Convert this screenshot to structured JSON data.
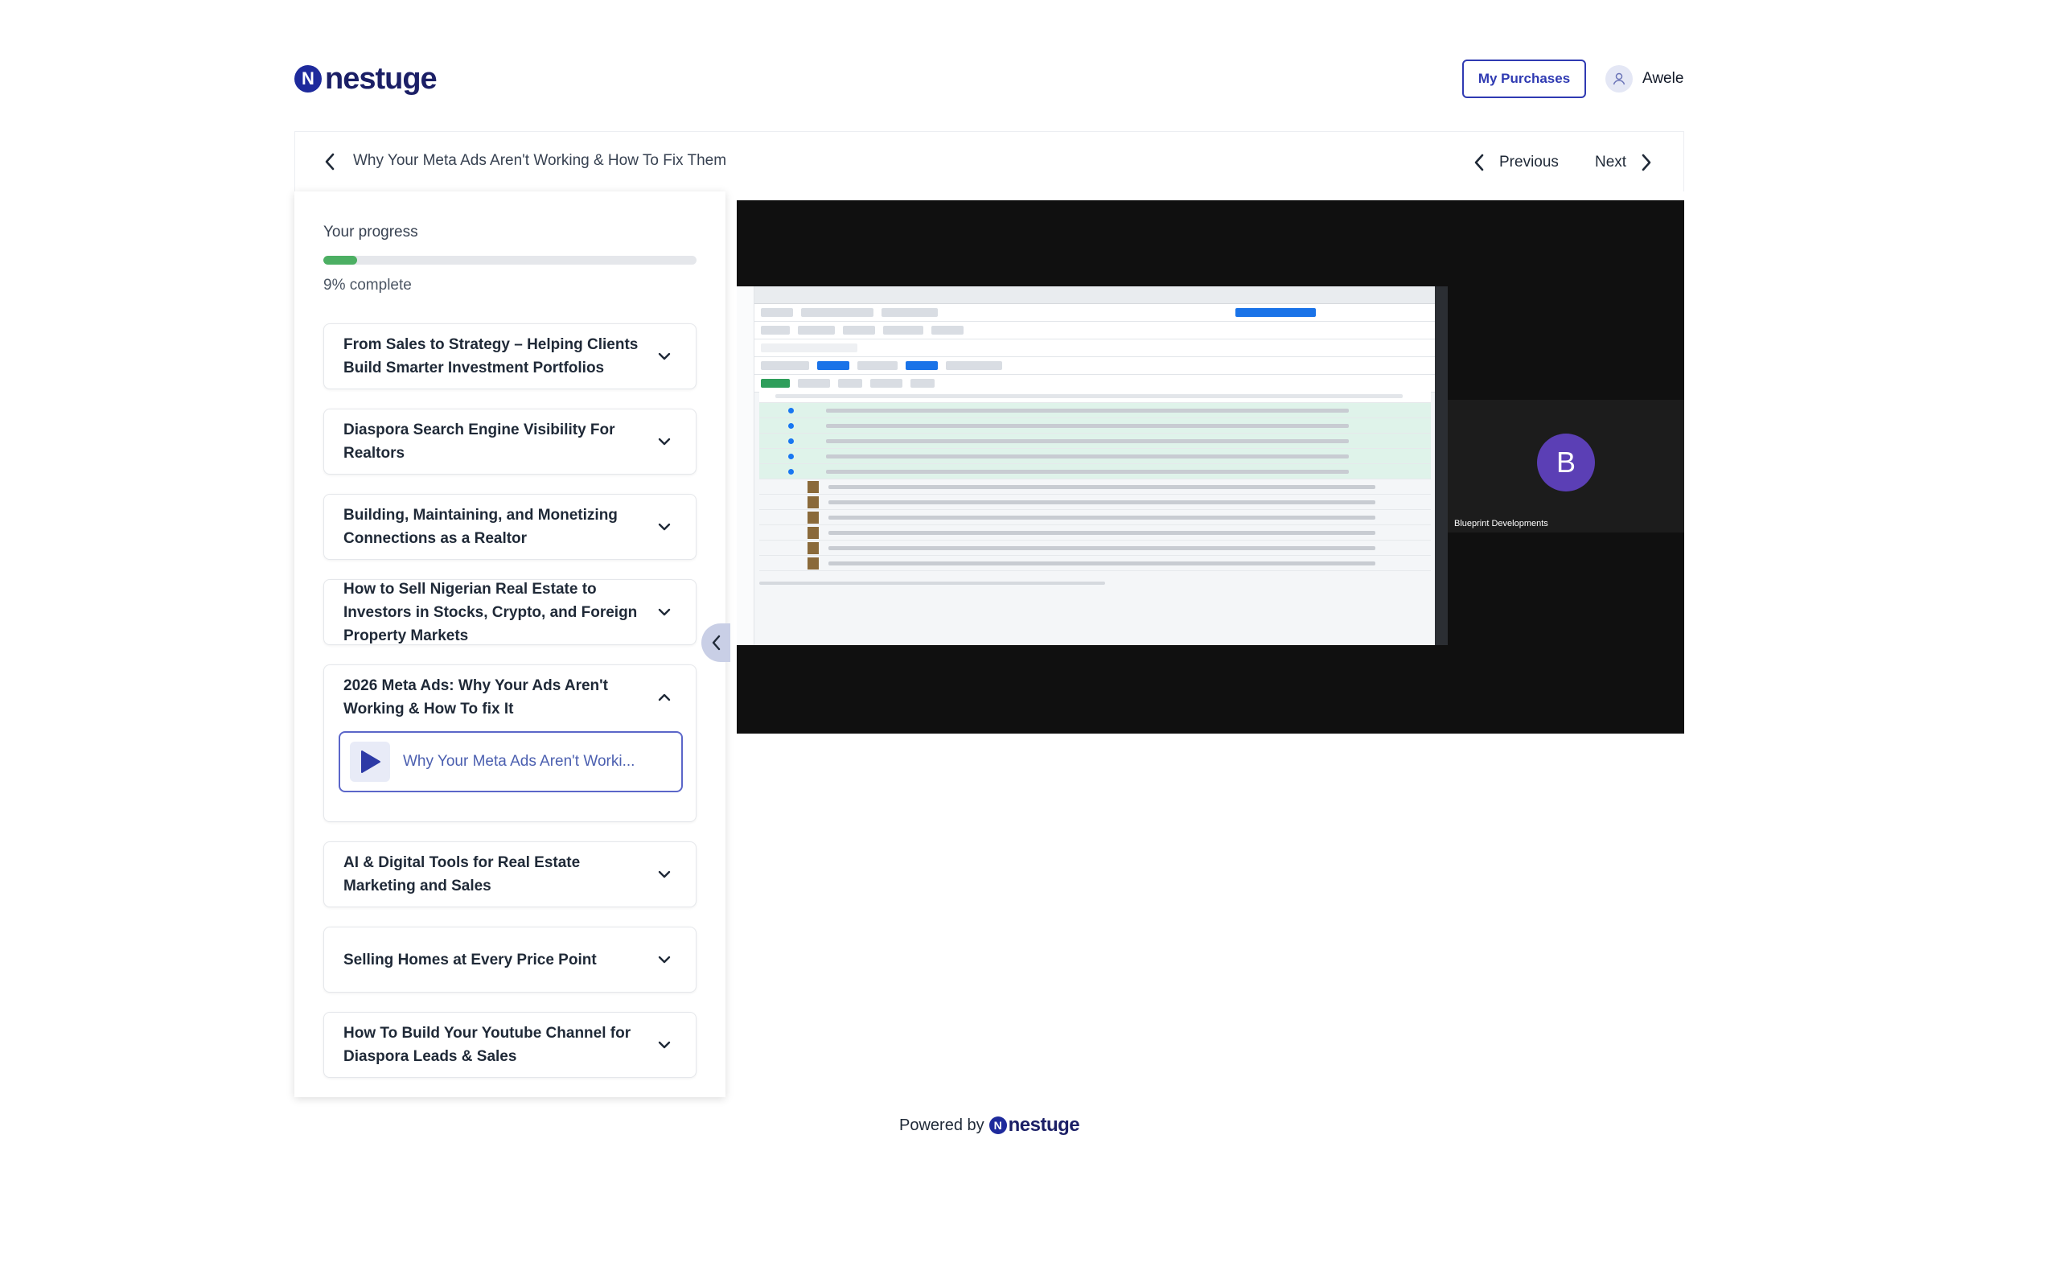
{
  "brand": {
    "mark": "N",
    "name": "nestuge"
  },
  "header": {
    "purchases_label": "My Purchases",
    "user_name": "Awele"
  },
  "lesson_bar": {
    "title": "Why Your Meta Ads Aren't Working & How To Fix Them",
    "previous_label": "Previous",
    "next_label": "Next"
  },
  "progress": {
    "label": "Your progress",
    "percent": 9,
    "text": "9% complete"
  },
  "modules": [
    {
      "title": "From Sales to Strategy – Helping Clients Build Smarter Investment Portfolios",
      "expanded": false
    },
    {
      "title": "Diaspora Search Engine Visibility For Realtors",
      "expanded": false
    },
    {
      "title": "Building, Maintaining, and Monetizing Connections as a Realtor",
      "expanded": false
    },
    {
      "title": "How to Sell Nigerian Real Estate to Investors in Stocks, Crypto, and Foreign Property Markets",
      "expanded": false
    },
    {
      "title": "2026 Meta Ads: Why Your Ads Aren't Working & How To fix It",
      "expanded": true,
      "lessons": [
        {
          "label": "Why Your Meta Ads Aren't Worki..."
        }
      ]
    },
    {
      "title": "AI & Digital Tools for Real Estate Marketing and Sales",
      "expanded": false
    },
    {
      "title": "Selling Homes at Every Price Point",
      "expanded": false
    },
    {
      "title": "How To Build Your Youtube Channel for Diaspora Leads & Sales",
      "expanded": false
    }
  ],
  "video": {
    "participant_initial": "B",
    "participant_name": "Blueprint Developments"
  },
  "footer": {
    "powered_by": "Powered by"
  },
  "colors": {
    "accent": "#2f3ab2",
    "brand": "#1b1f66",
    "progress": "#4caf63",
    "lesson_border": "#5b66c9"
  }
}
